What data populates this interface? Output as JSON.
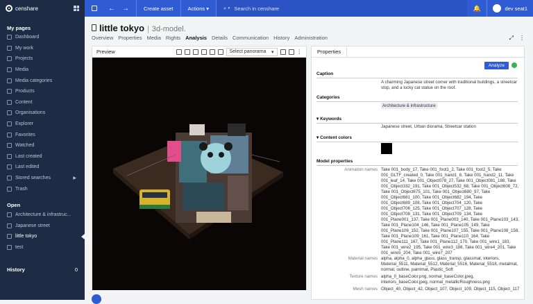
{
  "app": {
    "brand": "censhare"
  },
  "topbar": {
    "create_asset": "Create asset",
    "actions": "Actions ▾",
    "search_placeholder": "Search in censhare",
    "user": "dev seat1"
  },
  "sidebar": {
    "my_pages_title": "My pages",
    "my_pages": [
      "Dashboard",
      "My work",
      "Projects",
      "Media",
      "Media categories",
      "Products",
      "Content",
      "Organisations",
      "Explorer",
      "Favorites",
      "Watched",
      "Last created",
      "Last edited",
      "Stored searches",
      "Trash"
    ],
    "open_title": "Open",
    "open_items": [
      "Architecture & infrastruc...",
      "Japanese street",
      "little tokyo",
      "test"
    ],
    "history_title": "History",
    "history_count": "0"
  },
  "asset": {
    "title": "little tokyo",
    "type": "3d-model."
  },
  "tabs": [
    "Overview",
    "Properties",
    "Media",
    "Rights",
    "Analysis",
    "Details",
    "Communication",
    "History",
    "Administration"
  ],
  "preview": {
    "title": "Preview",
    "panorama": "Select panorama"
  },
  "properties": {
    "tab": "Properties",
    "analyze": "Analyze",
    "caption_title": "Caption",
    "caption": "A charming Japanese street corner with traditional buildings, a streetcar stop, and a lucky cat statue on the roof.",
    "categories_title": "Categories",
    "category": "Architecture & infrastructure",
    "keywords_title": "Keywords",
    "keywords": "Japanese street,  Urban diorama,  Streetcar station",
    "colors_title": "Content colors",
    "color": "#000000",
    "model_title": "Model properties",
    "animation_label": "Animation names",
    "animation": "Take 001_body_17, Take 001_foot1_2, Take 001_foot2_5, Take 001_GLTF_created_0, Take 001_hand1_8, Take 001_hand2_11, Take 001_leaf_14, Take 001_Object078_27, Take 001_Object081_188, Take 001_Object332_191, Take 001_Object532_68, Take 001_Object608_72, Take 001_Object675_101, Take 001_Object680_97, Take 001_Object681_100, Take 001_Object682_194, Take 001_Object689_108, Take 001_Object704_120, Take 001_Object706_125, Take 001_Object707_128, Take 001_Object708_131, Take 001_Object709_134, Take 001_Plane001_137, Take 001_Plane003_140, Take 001_Plane103_143, Take 001_Plane104_146, Take 001_Plane105_149, Take 001_Plane106_152, Take 001_Plane107_155, Take 001_Plane108_158, Take 001_Plane109_161, Take 001_Plane110_164, Take 001_Plane111_167, Take 001_Plane112_170, Take 001_wire1_183, Take 001_wire2_195, Take 001_wire3_198, Take 001_wire4_201, Take 001_wire5_204, Take 001_wire7_207",
    "material_label": "Material names",
    "material": "alpha, alpha_0, alpha_glass, glass_transp, glassmat, interiors, Material_5511, Material_5512, Material_5516, Material_5518, metalmat, normal, outline, paintmat, Plastic_Soft",
    "texture_label": "Texture names",
    "texture": "alpha_0_baseColor.png, normal_baseColor.jpeg, interiors_baseColor.jpeg, normal_metallicRoughness.png",
    "mesh_label": "Mesh names",
    "mesh": "Object_40, Object_42, Object_107, Object_109, Object_115, Object_117"
  }
}
